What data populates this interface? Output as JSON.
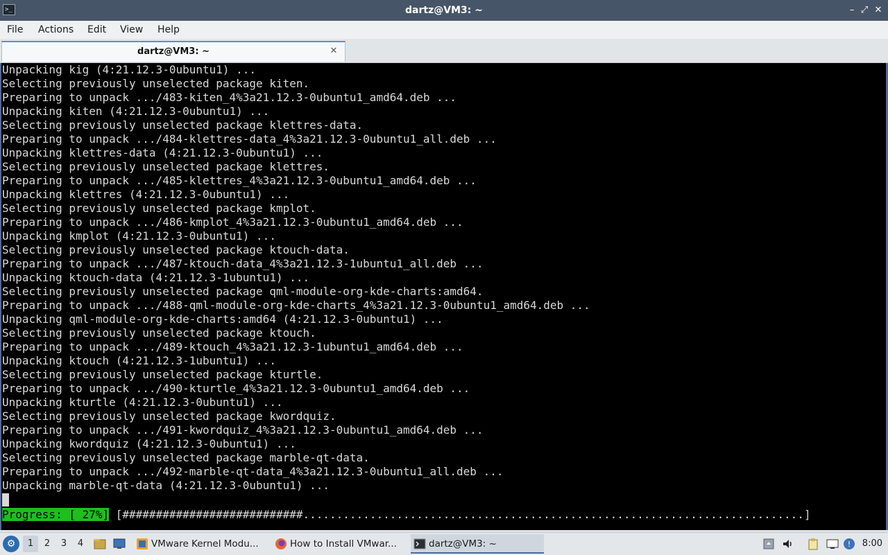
{
  "window": {
    "title": "dartz@VM3: ~",
    "app_icon_glyph": ">_",
    "buttons": {
      "minimize": "–",
      "maximize": "⤢",
      "close": "✕"
    }
  },
  "menu": [
    "File",
    "Actions",
    "Edit",
    "View",
    "Help"
  ],
  "tab": {
    "label": "dartz@VM3: ~",
    "close_glyph": "✕"
  },
  "terminal": {
    "lines": [
      "Unpacking kig (4:21.12.3-0ubuntu1) ...",
      "Selecting previously unselected package kiten.",
      "Preparing to unpack .../483-kiten_4%3a21.12.3-0ubuntu1_amd64.deb ...",
      "Unpacking kiten (4:21.12.3-0ubuntu1) ...",
      "Selecting previously unselected package klettres-data.",
      "Preparing to unpack .../484-klettres-data_4%3a21.12.3-0ubuntu1_all.deb ...",
      "Unpacking klettres-data (4:21.12.3-0ubuntu1) ...",
      "Selecting previously unselected package klettres.",
      "Preparing to unpack .../485-klettres_4%3a21.12.3-0ubuntu1_amd64.deb ...",
      "Unpacking klettres (4:21.12.3-0ubuntu1) ...",
      "Selecting previously unselected package kmplot.",
      "Preparing to unpack .../486-kmplot_4%3a21.12.3-0ubuntu1_amd64.deb ...",
      "Unpacking kmplot (4:21.12.3-0ubuntu1) ...",
      "Selecting previously unselected package ktouch-data.",
      "Preparing to unpack .../487-ktouch-data_4%3a21.12.3-1ubuntu1_all.deb ...",
      "Unpacking ktouch-data (4:21.12.3-1ubuntu1) ...",
      "Selecting previously unselected package qml-module-org-kde-charts:amd64.",
      "Preparing to unpack .../488-qml-module-org-kde-charts_4%3a21.12.3-0ubuntu1_amd64.deb ...",
      "Unpacking qml-module-org-kde-charts:amd64 (4:21.12.3-0ubuntu1) ...",
      "Selecting previously unselected package ktouch.",
      "Preparing to unpack .../489-ktouch_4%3a21.12.3-1ubuntu1_amd64.deb ...",
      "Unpacking ktouch (4:21.12.3-1ubuntu1) ...",
      "Selecting previously unselected package kturtle.",
      "Preparing to unpack .../490-kturtle_4%3a21.12.3-0ubuntu1_amd64.deb ...",
      "Unpacking kturtle (4:21.12.3-0ubuntu1) ...",
      "Selecting previously unselected package kwordquiz.",
      "Preparing to unpack .../491-kwordquiz_4%3a21.12.3-0ubuntu1_amd64.deb ...",
      "Unpacking kwordquiz (4:21.12.3-0ubuntu1) ...",
      "Selecting previously unselected package marble-qt-data.",
      "Preparing to unpack .../492-marble-qt-data_4%3a21.12.3-0ubuntu1_all.deb ...",
      "Unpacking marble-qt-data (4:21.12.3-0ubuntu1) ..."
    ],
    "progress_label": "Progress: [ 27%]",
    "progress_bar": "[###########################...........................................................................]",
    "progress_percent": 27
  },
  "taskbar": {
    "desktops": [
      "1",
      "2",
      "3",
      "4"
    ],
    "active_desktop": "1",
    "tasks": [
      {
        "label": "VMware Kernel Modu...",
        "icon": "vmware-icon"
      },
      {
        "label": "How to Install VMwar...",
        "icon": "firefox-icon"
      },
      {
        "label": "dartz@VM3: ~",
        "icon": "terminal-icon"
      }
    ],
    "clock": "8:00"
  },
  "colors": {
    "titlebar": "#475569",
    "terminal_bg": "#000000",
    "terminal_fg": "#d8d8d8",
    "progress_green": "#1cbf1c",
    "accent": "#4a6a9a"
  }
}
